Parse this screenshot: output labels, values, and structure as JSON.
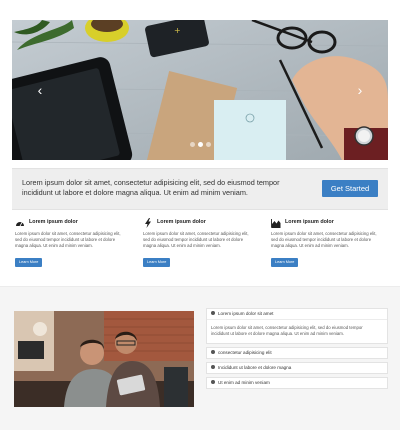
{
  "hero": {
    "prev_icon": "chevron-left-icon",
    "next_icon": "chevron-right-icon",
    "prev_glyph": "‹",
    "next_glyph": "›",
    "slide_count": 3,
    "active_slide": 1
  },
  "cta": {
    "text": "Lorem ipsum dolor sit amet, consectetur adipisicing elit, sed do eiusmod tempor incididunt ut labore et dolore magna aliqua. Ut enim ad minim veniam.",
    "button_label": "Get Started",
    "button_color": "#3b7fc4"
  },
  "features": [
    {
      "icon": "dashboard-icon",
      "title": "Lorem ipsum dolor",
      "text": "Lorem ipsum dolor sit amet, consectetur adipisicing elit, sed do eiusmod tempor incididunt ut labore et dolore magna aliqua. Ut enim ad minim veniam.",
      "button_label": "Learn More"
    },
    {
      "icon": "bolt-icon",
      "title": "Lorem ipsum dolor",
      "text": "Lorem ipsum dolor sit amet, consectetur adipisicing elit, sed do eiusmod tempor incididunt ut labore et dolore magna aliqua. Ut enim ad minim veniam.",
      "button_label": "Learn More"
    },
    {
      "icon": "area-chart-icon",
      "title": "Lorem ipsum dolor",
      "text": "Lorem ipsum dolor sit amet, consectetur adipisicing elit, sed do eiusmod tempor incididunt ut labore et dolore magna aliqua. Ut enim ad minim veniam.",
      "button_label": "Learn More"
    }
  ],
  "accordion": [
    {
      "label": "Lorem ipsum dolor sit amet",
      "expanded": true,
      "body": "Lorem ipsum dolor sit amet, consectetur adipisicing elit, sed do eiusmod tempor incididunt ut labore et dolore magna aliqua. Ut enim ad minim veniam."
    },
    {
      "label": "consectetur adipisicing elit",
      "expanded": false
    },
    {
      "label": "Incididunt ut labore et dolore magna",
      "expanded": false
    },
    {
      "label": "Ut enim ad minim veniam",
      "expanded": false
    }
  ]
}
